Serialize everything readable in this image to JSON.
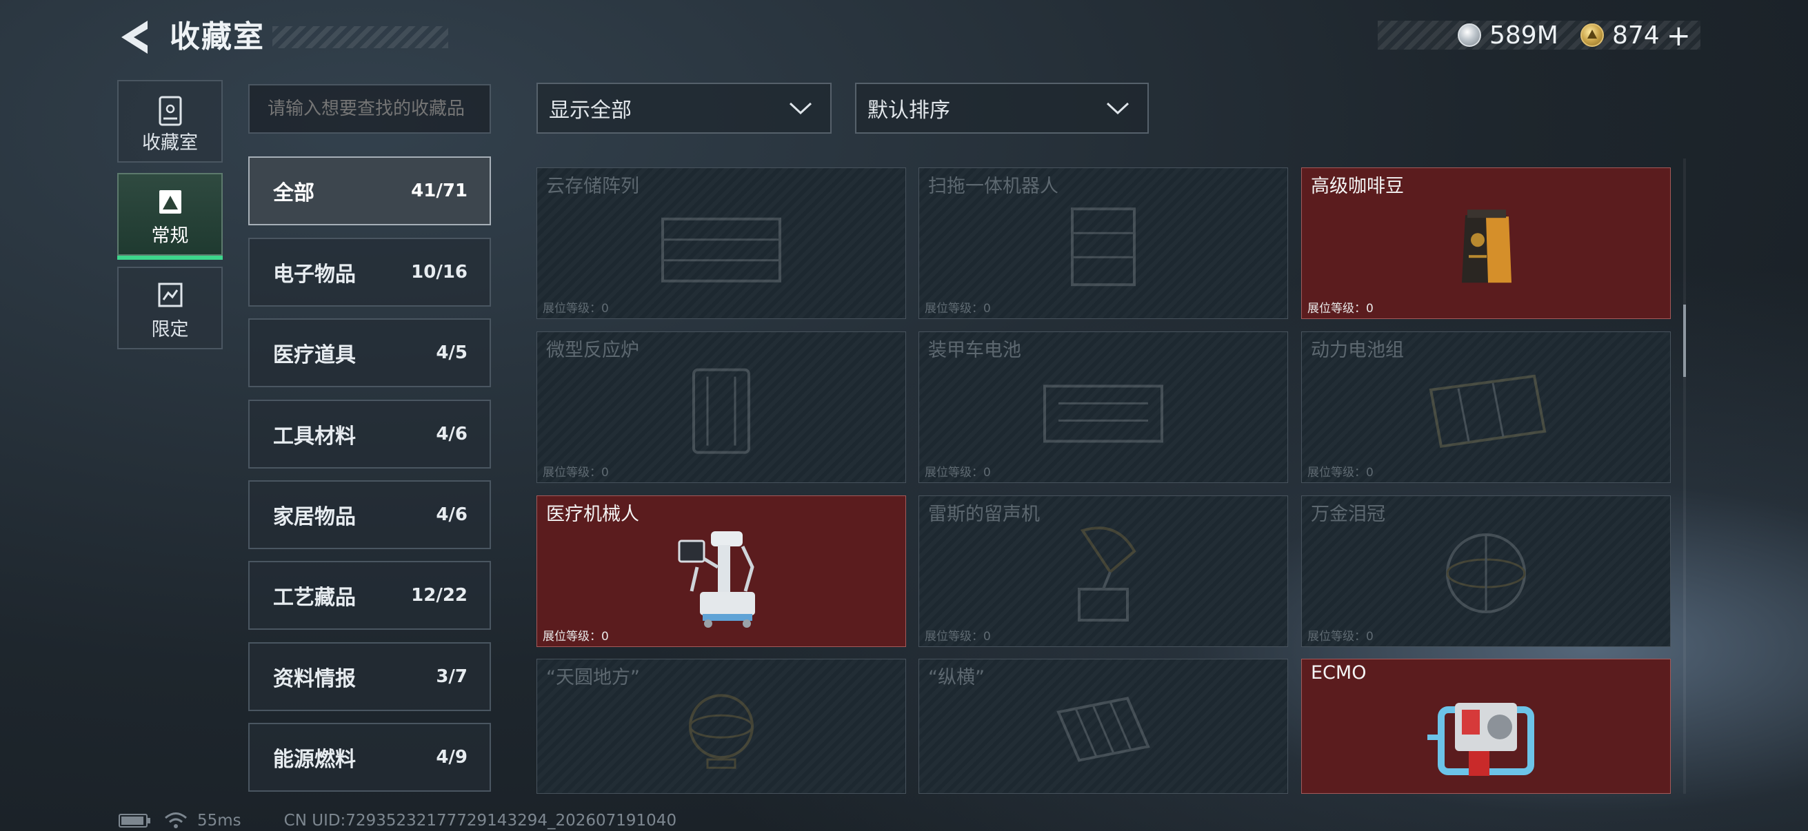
{
  "header": {
    "title": "收藏室"
  },
  "currency": {
    "silver": "589M",
    "gold": "874",
    "plus": "+"
  },
  "side_tabs": [
    {
      "label": "收藏室",
      "active": false
    },
    {
      "label": "常规",
      "active": true
    },
    {
      "label": "限定",
      "active": false
    }
  ],
  "search": {
    "placeholder": "请输入想要查找的收藏品"
  },
  "categories": [
    {
      "label": "全部",
      "count": "41/71",
      "active": true
    },
    {
      "label": "电子物品",
      "count": "10/16"
    },
    {
      "label": "医疗道具",
      "count": "4/5"
    },
    {
      "label": "工具材料",
      "count": "4/6"
    },
    {
      "label": "家居物品",
      "count": "4/6"
    },
    {
      "label": "工艺藏品",
      "count": "12/22"
    },
    {
      "label": "资料情报",
      "count": "3/7"
    },
    {
      "label": "能源燃料",
      "count": "4/9"
    }
  ],
  "filters": {
    "show": "显示全部",
    "sort": "默认排序"
  },
  "items": [
    {
      "name": "云存储阵列",
      "level": "展位等级：0",
      "owned": false,
      "icon": "server-rack-icon"
    },
    {
      "name": "扫拖一体机器人",
      "level": "展位等级：0",
      "owned": false,
      "icon": "robot-vacuum-icon"
    },
    {
      "name": "高级咖啡豆",
      "level": "展位等级：0",
      "owned": true,
      "icon": "coffee-bag-icon"
    },
    {
      "name": "微型反应炉",
      "level": "展位等级：0",
      "owned": false,
      "icon": "reactor-icon"
    },
    {
      "name": "装甲车电池",
      "level": "展位等级：0",
      "owned": false,
      "icon": "battery-icon"
    },
    {
      "name": "动力电池组",
      "level": "展位等级：0",
      "owned": false,
      "icon": "battery-pack-icon"
    },
    {
      "name": "医疗机械人",
      "level": "展位等级：0",
      "owned": true,
      "icon": "medical-robot-icon"
    },
    {
      "name": "雷斯的留声机",
      "level": "展位等级：0",
      "owned": false,
      "icon": "gramophone-icon"
    },
    {
      "name": "万金泪冠",
      "level": "展位等级：0",
      "owned": false,
      "icon": "crown-icon"
    },
    {
      "name": "“天圆地方”",
      "level": "",
      "owned": false,
      "icon": "globe-icon"
    },
    {
      "name": "“纵横”",
      "level": "",
      "owned": false,
      "icon": "chessboard-icon"
    },
    {
      "name": "ECMO",
      "level": "",
      "owned": true,
      "icon": "ecmo-machine-icon"
    }
  ],
  "footer": {
    "ping": "55ms",
    "uid": "CN UID:729352321777291432​94_202607191040"
  },
  "colors": {
    "owned_card": "#5b1c1e",
    "active_tab": "#3dd68c"
  }
}
